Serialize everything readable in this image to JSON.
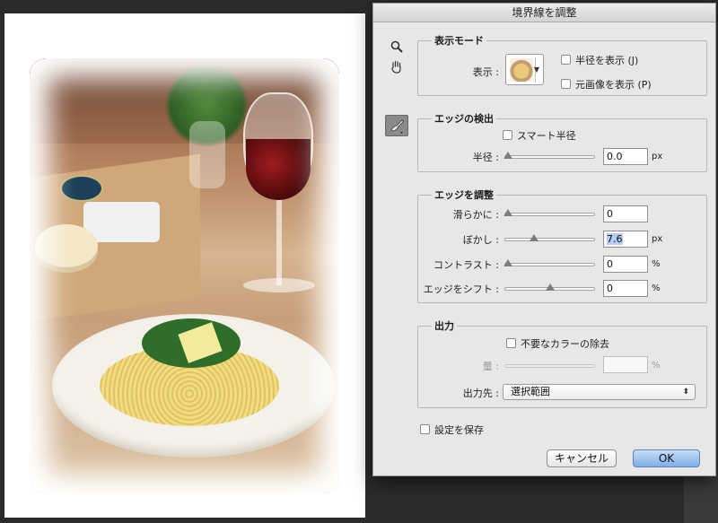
{
  "dialog": {
    "title": "境界線を調整",
    "display_mode": {
      "title": "表示モード",
      "view_label": "表示 :",
      "show_radius": "半径を表示 (J)",
      "show_original": "元画像を表示 (P)"
    },
    "edge_detection": {
      "title": "エッジの検出",
      "smart_radius": "スマート半径",
      "radius_label": "半径 :",
      "radius_value": "0.0",
      "radius_unit": "px"
    },
    "adjust_edge": {
      "title": "エッジを調整",
      "smooth_label": "滑らかに :",
      "smooth_value": "0",
      "feather_label": "ぼかし :",
      "feather_value": "7.6",
      "feather_unit": "px",
      "contrast_label": "コントラスト :",
      "contrast_value": "0",
      "contrast_unit": "%",
      "shift_label": "エッジをシフト :",
      "shift_value": "0",
      "shift_unit": "%"
    },
    "output": {
      "title": "出力",
      "decontaminate": "不要なカラーの除去",
      "amount_label": "量 :",
      "amount_value": "",
      "amount_unit": "%",
      "output_to_label": "出力先 :",
      "output_to_value": "選択範囲"
    },
    "remember": "設定を保存",
    "cancel_label": "キャンセル",
    "ok_label": "OK"
  }
}
